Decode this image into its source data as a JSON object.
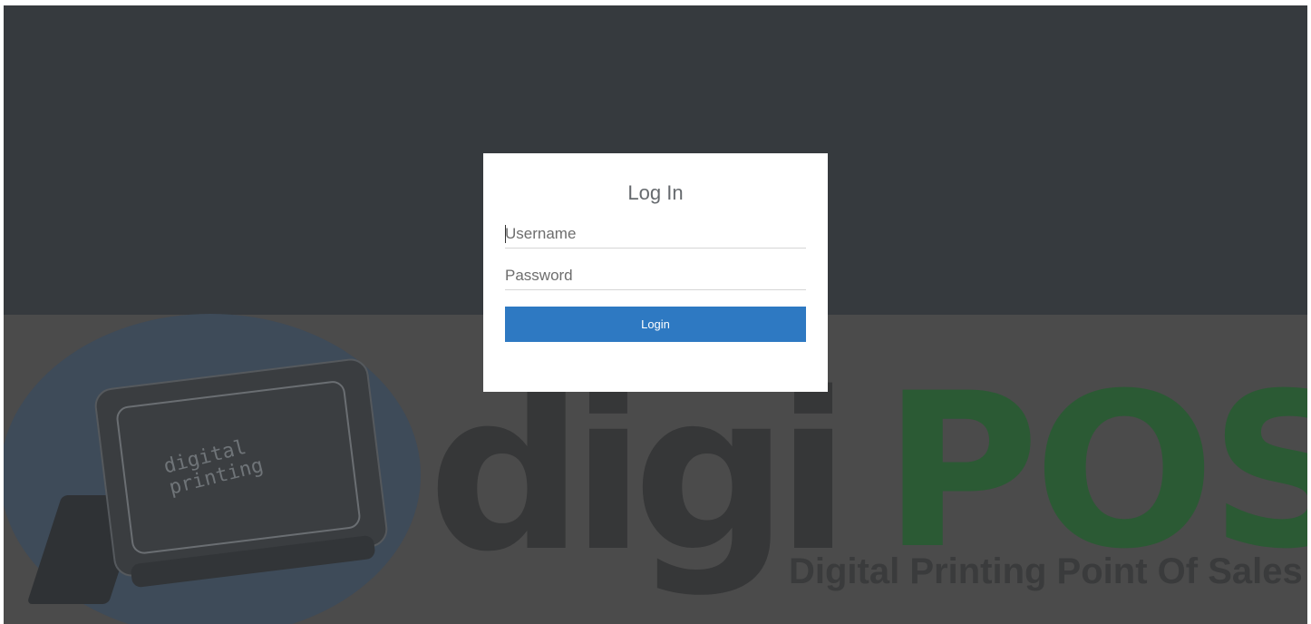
{
  "login": {
    "title": "Log In",
    "username": {
      "placeholder": "Username",
      "value": ""
    },
    "password": {
      "placeholder": "Password",
      "value": ""
    },
    "submit_label": "Login"
  },
  "branding": {
    "logo_device_text": "digital\nprinting",
    "logo_word_dark": "digi",
    "logo_word_green": "POS",
    "tagline": "Digital Printing Point Of Sales",
    "colors": {
      "top_band": "#363a3e",
      "lower_band": "#4b4b4b",
      "disc": "#3e4b59",
      "pos_green": "#2b5a34",
      "button_blue": "#2e79c2"
    }
  }
}
